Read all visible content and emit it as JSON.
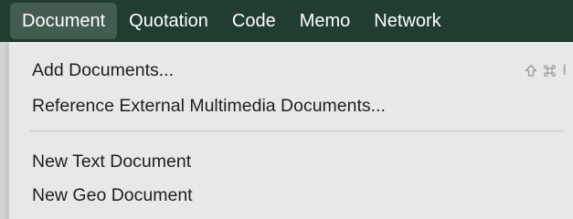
{
  "menubar": {
    "items": [
      {
        "label": "Document"
      },
      {
        "label": "Quotation"
      },
      {
        "label": "Code"
      },
      {
        "label": "Memo"
      },
      {
        "label": "Network"
      }
    ]
  },
  "dropdown": {
    "items": [
      {
        "label": "Add Documents...",
        "shortcut": {
          "modifiers": [
            "shift-icon",
            "command-icon"
          ],
          "key": "I"
        }
      },
      {
        "label": "Reference External Multimedia Documents..."
      },
      {
        "label": "New Text Document"
      },
      {
        "label": "New Geo Document"
      }
    ]
  },
  "colors": {
    "menubar_background": "#203d2f",
    "menu_background": "#e8e8e8",
    "menu_text": "#1f1f1f",
    "shortcut_text": "#9b9b9b"
  }
}
